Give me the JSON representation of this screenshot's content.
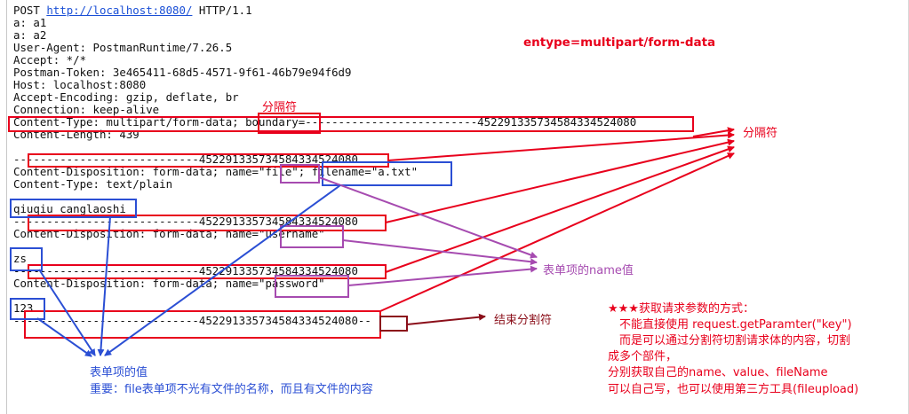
{
  "request": {
    "line1_method": "POST ",
    "line1_url": "http://localhost:8080/",
    "line1_proto": " HTTP/1.1",
    "lines": [
      "a: a1",
      "a: a2",
      "User-Agent: PostmanRuntime/7.26.5",
      "Accept: */*",
      "Postman-Token: 3e465411-68d5-4571-9f61-46b79e94f6d9",
      "Host: localhost:8080",
      "Accept-Encoding: gzip, deflate, br",
      "Connection: keep-alive",
      "Content-Type: multipart/form-data; boundary=--------------------------452291335734584334524080",
      "Content-Length: 439",
      "",
      "----------------------------452291335734584334524080",
      "Content-Disposition: form-data; name=\"file\"; filename=\"a.txt\"",
      "Content-Type: text/plain",
      "",
      "qiuqiu canglaoshi",
      "----------------------------452291335734584334524080",
      "Content-Disposition: form-data; name=\"username\"",
      "",
      "zs",
      "----------------------------452291335734584334524080",
      "Content-Disposition: form-data; name=\"password\"",
      "",
      "123",
      "----------------------------452291335734584334524080--"
    ]
  },
  "annotations": {
    "enctype": "entype=multipart/form-data",
    "separator_small": "分隔符",
    "separator_right": "分隔符",
    "name_value": "表单项的name值",
    "end_separator": "结束分割符",
    "field_value": "表单项的值",
    "important_note": "重要：file表单项不光有文件的名称，而且有文件的内容",
    "method_title": "★★★获取请求参数的方式：",
    "method_line1": "不能直接使用 request.getParamter(\"key\")",
    "method_line2": "而是可以通过分割符切割请求体的内容，切割",
    "method_line3": "成多个部件，",
    "method_line4": "分别获取自己的name、value、fileName",
    "method_line5": "可以自己写，也可以使用第三方工具(fileupload)"
  },
  "colors": {
    "red": "#e8001c",
    "blue": "#2b4fd4",
    "purple": "#a64bb0",
    "darkred": "#8b0f1a"
  }
}
